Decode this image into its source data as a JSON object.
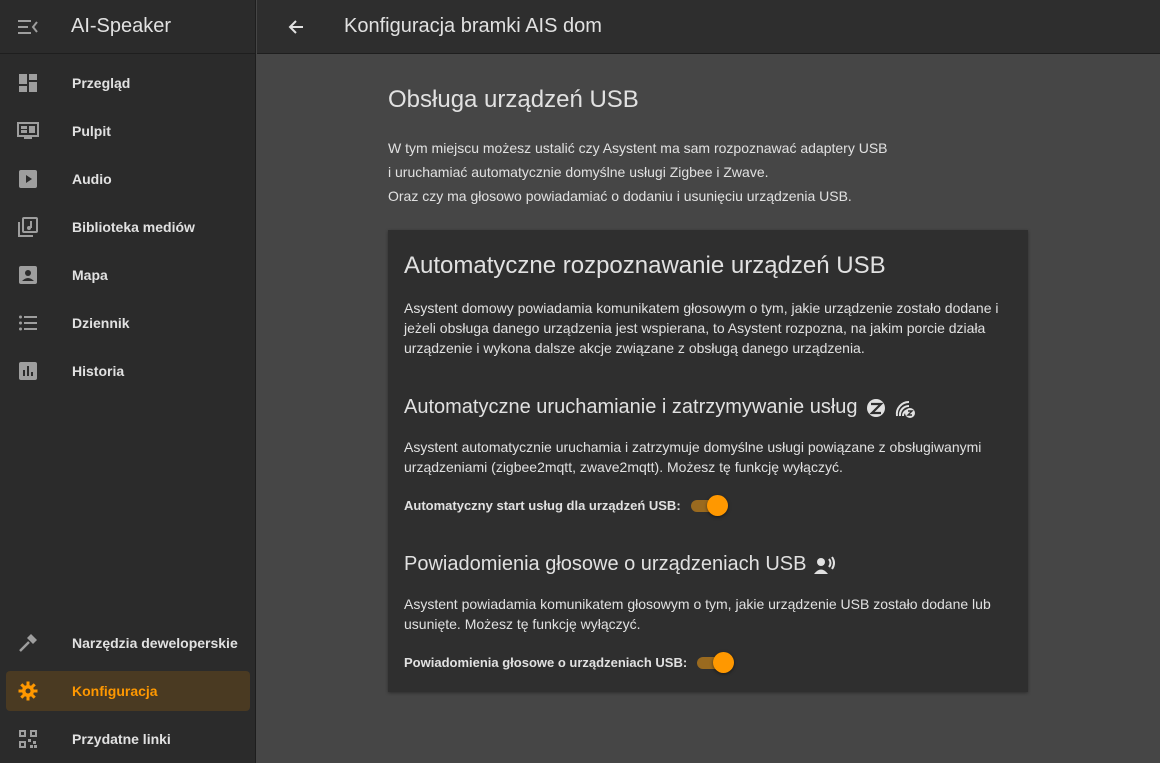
{
  "app": {
    "title": "AI-Speaker"
  },
  "topbar": {
    "title": "Konfiguracja bramki AIS dom"
  },
  "sidebar": {
    "items": [
      {
        "label": "Przegląd",
        "icon": "dashboard-icon"
      },
      {
        "label": "Pulpit",
        "icon": "monitor-dashboard-icon"
      },
      {
        "label": "Audio",
        "icon": "play-box-icon"
      },
      {
        "label": "Biblioteka mediów",
        "icon": "library-music-icon"
      },
      {
        "label": "Mapa",
        "icon": "account-box-icon"
      },
      {
        "label": "Dziennik",
        "icon": "format-list-bulleted-icon"
      },
      {
        "label": "Historia",
        "icon": "chart-box-icon"
      }
    ],
    "bottom_items": [
      {
        "label": "Narzędzia deweloperskie",
        "icon": "hammer-icon"
      },
      {
        "label": "Konfiguracja",
        "icon": "cog-icon",
        "active": true
      },
      {
        "label": "Przydatne linki",
        "icon": "qrcode-icon"
      }
    ]
  },
  "main": {
    "title": "Obsługa urządzeń USB",
    "intro": [
      "W tym miejscu możesz ustalić czy Asystent ma sam rozpoznawać adaptery USB",
      "i uruchamiać automatycznie domyślne usługi Zigbee i Zwave.",
      "Oraz czy ma głosowo powiadamiać o dodaniu i usunięciu urządzenia USB."
    ],
    "card": {
      "title": "Automatyczne rozpoznawanie urządzeń USB",
      "description": "Asystent domowy powiadamia komunikatem głosowym o tym, jakie urządzenie zostało dodane i jeżeli obsługa danego urządzenia jest wspierana, to Asystent rozpozna, na jakim porcie działa urządzenie i wykona dalsze akcje związane z obsługą danego urządzenia.",
      "section1": {
        "title": "Automatyczne uruchamianie i zatrzymywanie usług",
        "description": "Asystent automatycznie uruchamia i zatrzymuje domyślne usługi powiązane z obsługiwanymi urządzeniami (zigbee2mqtt, zwave2mqtt). Możesz tę funkcję wyłączyć.",
        "toggle_label": "Automatyczny start usług dla urządzeń USB:",
        "toggle_on": true
      },
      "section2": {
        "title": "Powiadomienia głosowe o urządzeniach USB",
        "description": "Asystent powiadamia komunikatem głosowym o tym, jakie urządzenie USB zostało dodane lub usunięte. Możesz tę funkcję wyłączyć.",
        "toggle_label": "Powiadomienia głosowe o urządzeniach USB:",
        "toggle_on": true
      }
    }
  },
  "colors": {
    "accent": "#ff9800",
    "sidebar_bg": "#2b2b2b",
    "main_bg": "#464646",
    "card_bg": "#2f2f2f"
  }
}
